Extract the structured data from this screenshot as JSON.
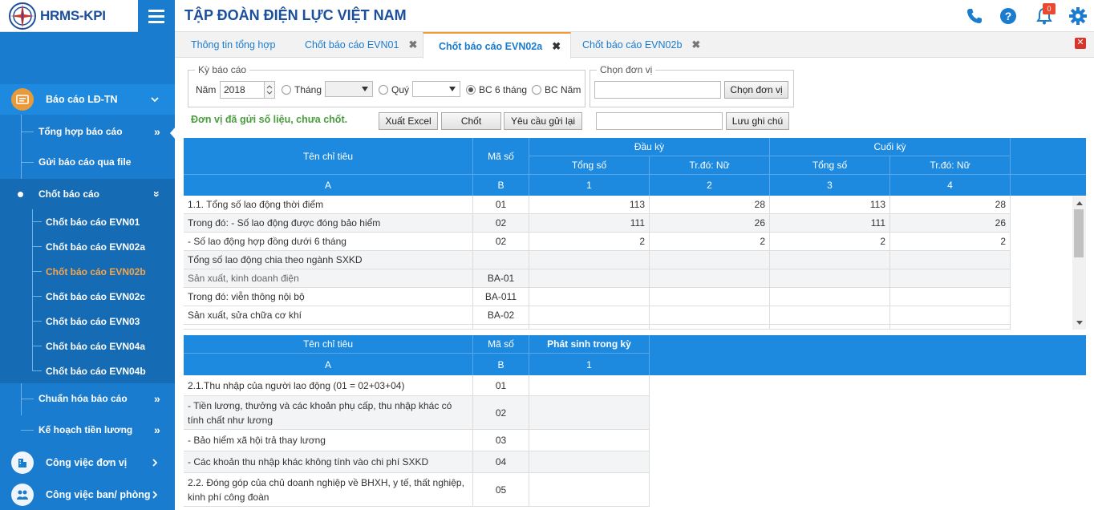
{
  "app": {
    "logo_text": "HRMS-KPI",
    "title": "TẬP ĐOÀN ĐIỆN LỰC VIỆT NAM",
    "notification_count": "0"
  },
  "colors": {
    "primary": "#1a7ccf",
    "accent": "#f29a33",
    "success_text": "#4a9d3e",
    "badge": "#e8492f"
  },
  "icons": {
    "phone": "phone-icon",
    "help": "help-icon",
    "bell": "bell-icon",
    "settings": "gear-icon"
  },
  "sidebar": {
    "groups": [
      {
        "label": "Báo cáo LĐ-TN",
        "icon": "report-icon"
      },
      {
        "label": "Công việc đơn vị",
        "icon": "building-icon"
      },
      {
        "label": "Công việc ban/ phòng",
        "icon": "team-icon"
      }
    ],
    "items": [
      {
        "label": "Tổng hợp báo cáo"
      },
      {
        "label": "Gửi báo cáo qua file"
      },
      {
        "label": "Chốt báo cáo"
      },
      {
        "label": "Chuẩn hóa báo cáo"
      },
      {
        "label": "Kế hoạch tiền lương"
      }
    ],
    "subitems": [
      {
        "label": "Chốt báo cáo EVN01"
      },
      {
        "label": "Chốt báo cáo EVN02a"
      },
      {
        "label": "Chốt báo cáo EVN02b"
      },
      {
        "label": "Chốt báo cáo EVN02c"
      },
      {
        "label": "Chốt báo cáo EVN03"
      },
      {
        "label": "Chốt báo cáo EVN04a"
      },
      {
        "label": "Chốt báo cáo EVN04b"
      }
    ]
  },
  "tabs": [
    {
      "label": "Thông tin tổng hợp"
    },
    {
      "label": "Chốt báo cáo EVN01"
    },
    {
      "label": "Chốt báo cáo EVN02a"
    },
    {
      "label": "Chốt báo cáo EVN02b"
    }
  ],
  "filter": {
    "period_legend": "Kỳ báo cáo",
    "year_label": "Năm",
    "year_value": "2018",
    "month_label": "Tháng",
    "quarter_label": "Quý",
    "half_label": "BC 6 tháng",
    "annual_label": "BC Năm",
    "selected_period": "BC 6 tháng",
    "unit_legend": "Chọn đơn vị",
    "unit_value": "",
    "unit_button": "Chọn đơn vị",
    "note_value": "",
    "note_button": "Lưu ghi chú"
  },
  "actions": {
    "status": "Đơn vị đã gửi số liệu, chưa chốt.",
    "export": "Xuất Excel",
    "close": "Chốt",
    "resend": "Yêu cầu gửi lại"
  },
  "table1": {
    "headers": {
      "name": "Tên chỉ tiêu",
      "code": "Mã số",
      "start": "Đầu kỳ",
      "end": "Cuối kỳ",
      "total1": "Tổng số",
      "female1": "Tr.đó: Nữ",
      "total2": "Tổng số",
      "female2": "Tr.đó: Nữ",
      "idx_name": "A",
      "idx_code": "B",
      "idx1": "1",
      "idx2": "2",
      "idx3": "3",
      "idx4": "4"
    },
    "rows": [
      {
        "name": "1.1. Tổng số lao động thời điểm",
        "code": "01",
        "v1": "113",
        "v2": "28",
        "v3": "113",
        "v4": "28"
      },
      {
        "name": "Trong đó: - Số lao động được đóng bảo hiểm",
        "code": "02",
        "v1": "111",
        "v2": "26",
        "v3": "111",
        "v4": "26"
      },
      {
        "name": "- Số lao động hợp đồng dưới 6 tháng",
        "code": "02",
        "v1": "2",
        "v2": "2",
        "v3": "2",
        "v4": "2"
      },
      {
        "name": "Tổng số lao động chia theo ngành SXKD",
        "code": "",
        "v1": "",
        "v2": "",
        "v3": "",
        "v4": ""
      },
      {
        "name": "Sản xuất, kinh doanh điện",
        "code": "BA-01",
        "v1": "",
        "v2": "",
        "v3": "",
        "v4": ""
      },
      {
        "name": "Trong đó: viễn thông nội bộ",
        "code": "BA-011",
        "v1": "",
        "v2": "",
        "v3": "",
        "v4": ""
      },
      {
        "name": "Sản xuất, sửa chữa cơ khí",
        "code": "BA-02",
        "v1": "",
        "v2": "",
        "v3": "",
        "v4": ""
      }
    ]
  },
  "table2": {
    "headers": {
      "name": "Tên chỉ tiêu",
      "code": "Mã số",
      "amount": "Phát sinh trong kỳ",
      "idx_name": "A",
      "idx_code": "B",
      "idx1": "1"
    },
    "rows": [
      {
        "name": "2.1.Thu nhập của người lao động (01 = 02+03+04)",
        "code": "01",
        "v1": ""
      },
      {
        "name": "- Tiền lương, thưởng và các khoản phụ cấp, thu nhập khác có tính chất như lương",
        "code": "02",
        "v1": ""
      },
      {
        "name": "- Bảo hiểm xã hội trả thay lương",
        "code": "03",
        "v1": ""
      },
      {
        "name": "- Các khoản thu nhập khác không tính vào chi phí SXKD",
        "code": "04",
        "v1": ""
      },
      {
        "name": "2.2. Đóng góp của chủ doanh nghiệp về BHXH, y tế, thất nghiệp, kinh phí công đoàn",
        "code": "05",
        "v1": ""
      }
    ]
  }
}
